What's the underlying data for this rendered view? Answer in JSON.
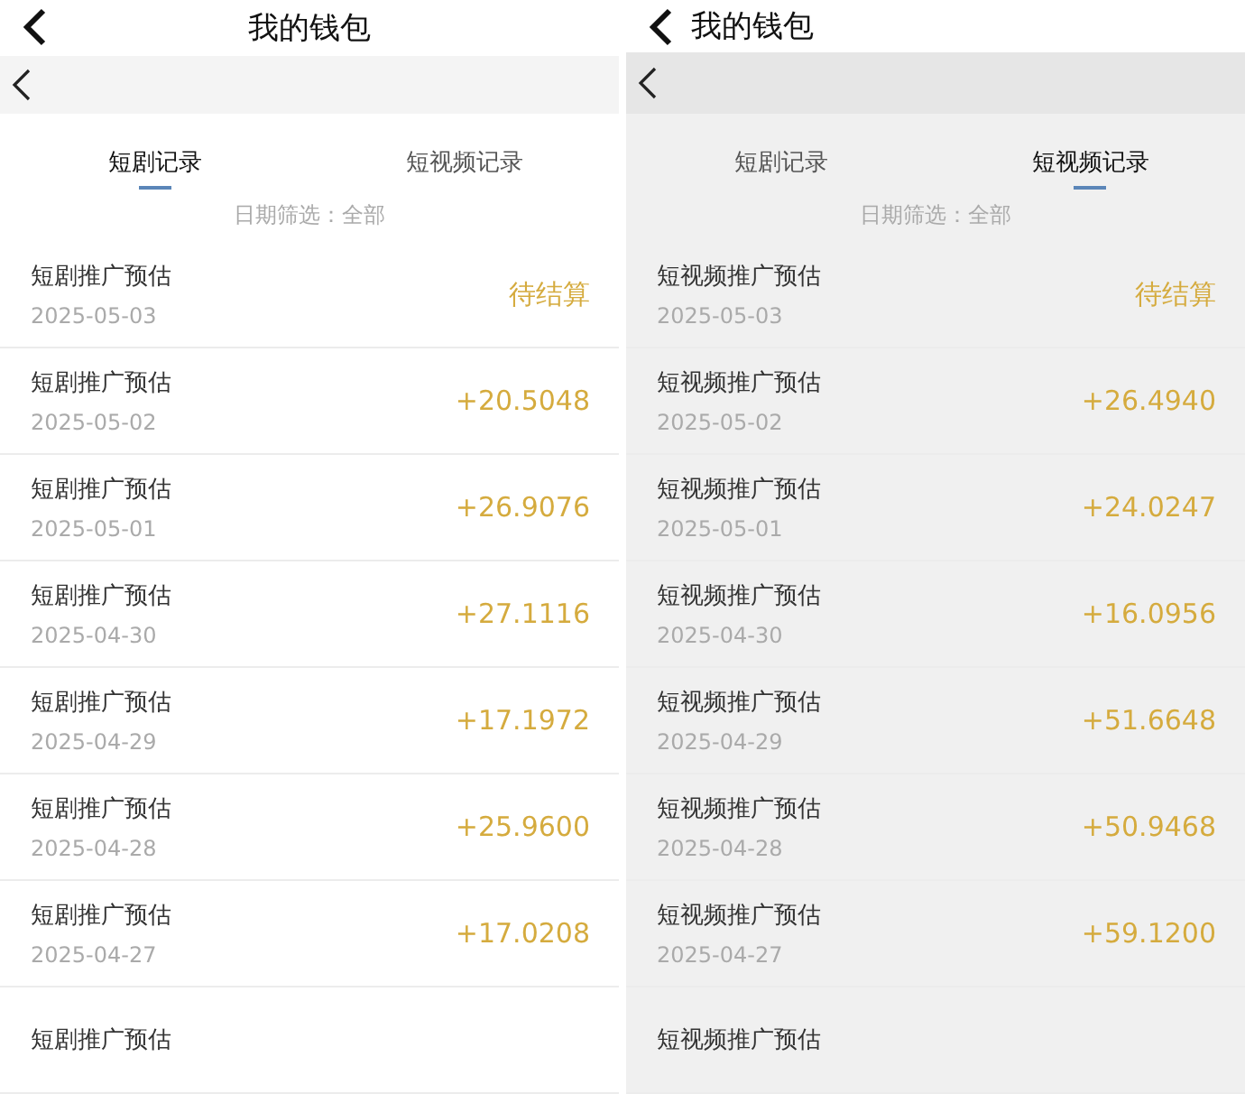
{
  "screens": [
    {
      "title": "我的钱包",
      "dimmed": false,
      "tabs": [
        {
          "label": "短剧记录",
          "selected": true
        },
        {
          "label": "短视频记录",
          "selected": false
        }
      ],
      "filter": "日期筛选：全部",
      "records": [
        {
          "title": "短剧推广预估",
          "date": "2025-05-03",
          "amount": "待结算"
        },
        {
          "title": "短剧推广预估",
          "date": "2025-05-02",
          "amount": "+20.5048"
        },
        {
          "title": "短剧推广预估",
          "date": "2025-05-01",
          "amount": "+26.9076"
        },
        {
          "title": "短剧推广预估",
          "date": "2025-04-30",
          "amount": "+27.1116"
        },
        {
          "title": "短剧推广预估",
          "date": "2025-04-29",
          "amount": "+17.1972"
        },
        {
          "title": "短剧推广预估",
          "date": "2025-04-28",
          "amount": "+25.9600"
        },
        {
          "title": "短剧推广预估",
          "date": "2025-04-27",
          "amount": "+17.0208"
        },
        {
          "title": "短剧推广预估"
        }
      ]
    },
    {
      "title": "我的钱包",
      "dimmed": true,
      "tabs": [
        {
          "label": "短剧记录",
          "selected": false
        },
        {
          "label": "短视频记录",
          "selected": true
        }
      ],
      "filter": "日期筛选：全部",
      "records": [
        {
          "title": "短视频推广预估",
          "date": "2025-05-03",
          "amount": "待结算"
        },
        {
          "title": "短视频推广预估",
          "date": "2025-05-02",
          "amount": "+26.4940"
        },
        {
          "title": "短视频推广预估",
          "date": "2025-05-01",
          "amount": "+24.0247"
        },
        {
          "title": "短视频推广预估",
          "date": "2025-04-30",
          "amount": "+16.0956"
        },
        {
          "title": "短视频推广预估",
          "date": "2025-04-29",
          "amount": "+51.6648"
        },
        {
          "title": "短视频推广预估",
          "date": "2025-04-28",
          "amount": "+50.9468"
        },
        {
          "title": "短视频推广预估",
          "date": "2025-04-27",
          "amount": "+59.1200"
        },
        {
          "title": "短视频推广预估"
        }
      ]
    }
  ]
}
